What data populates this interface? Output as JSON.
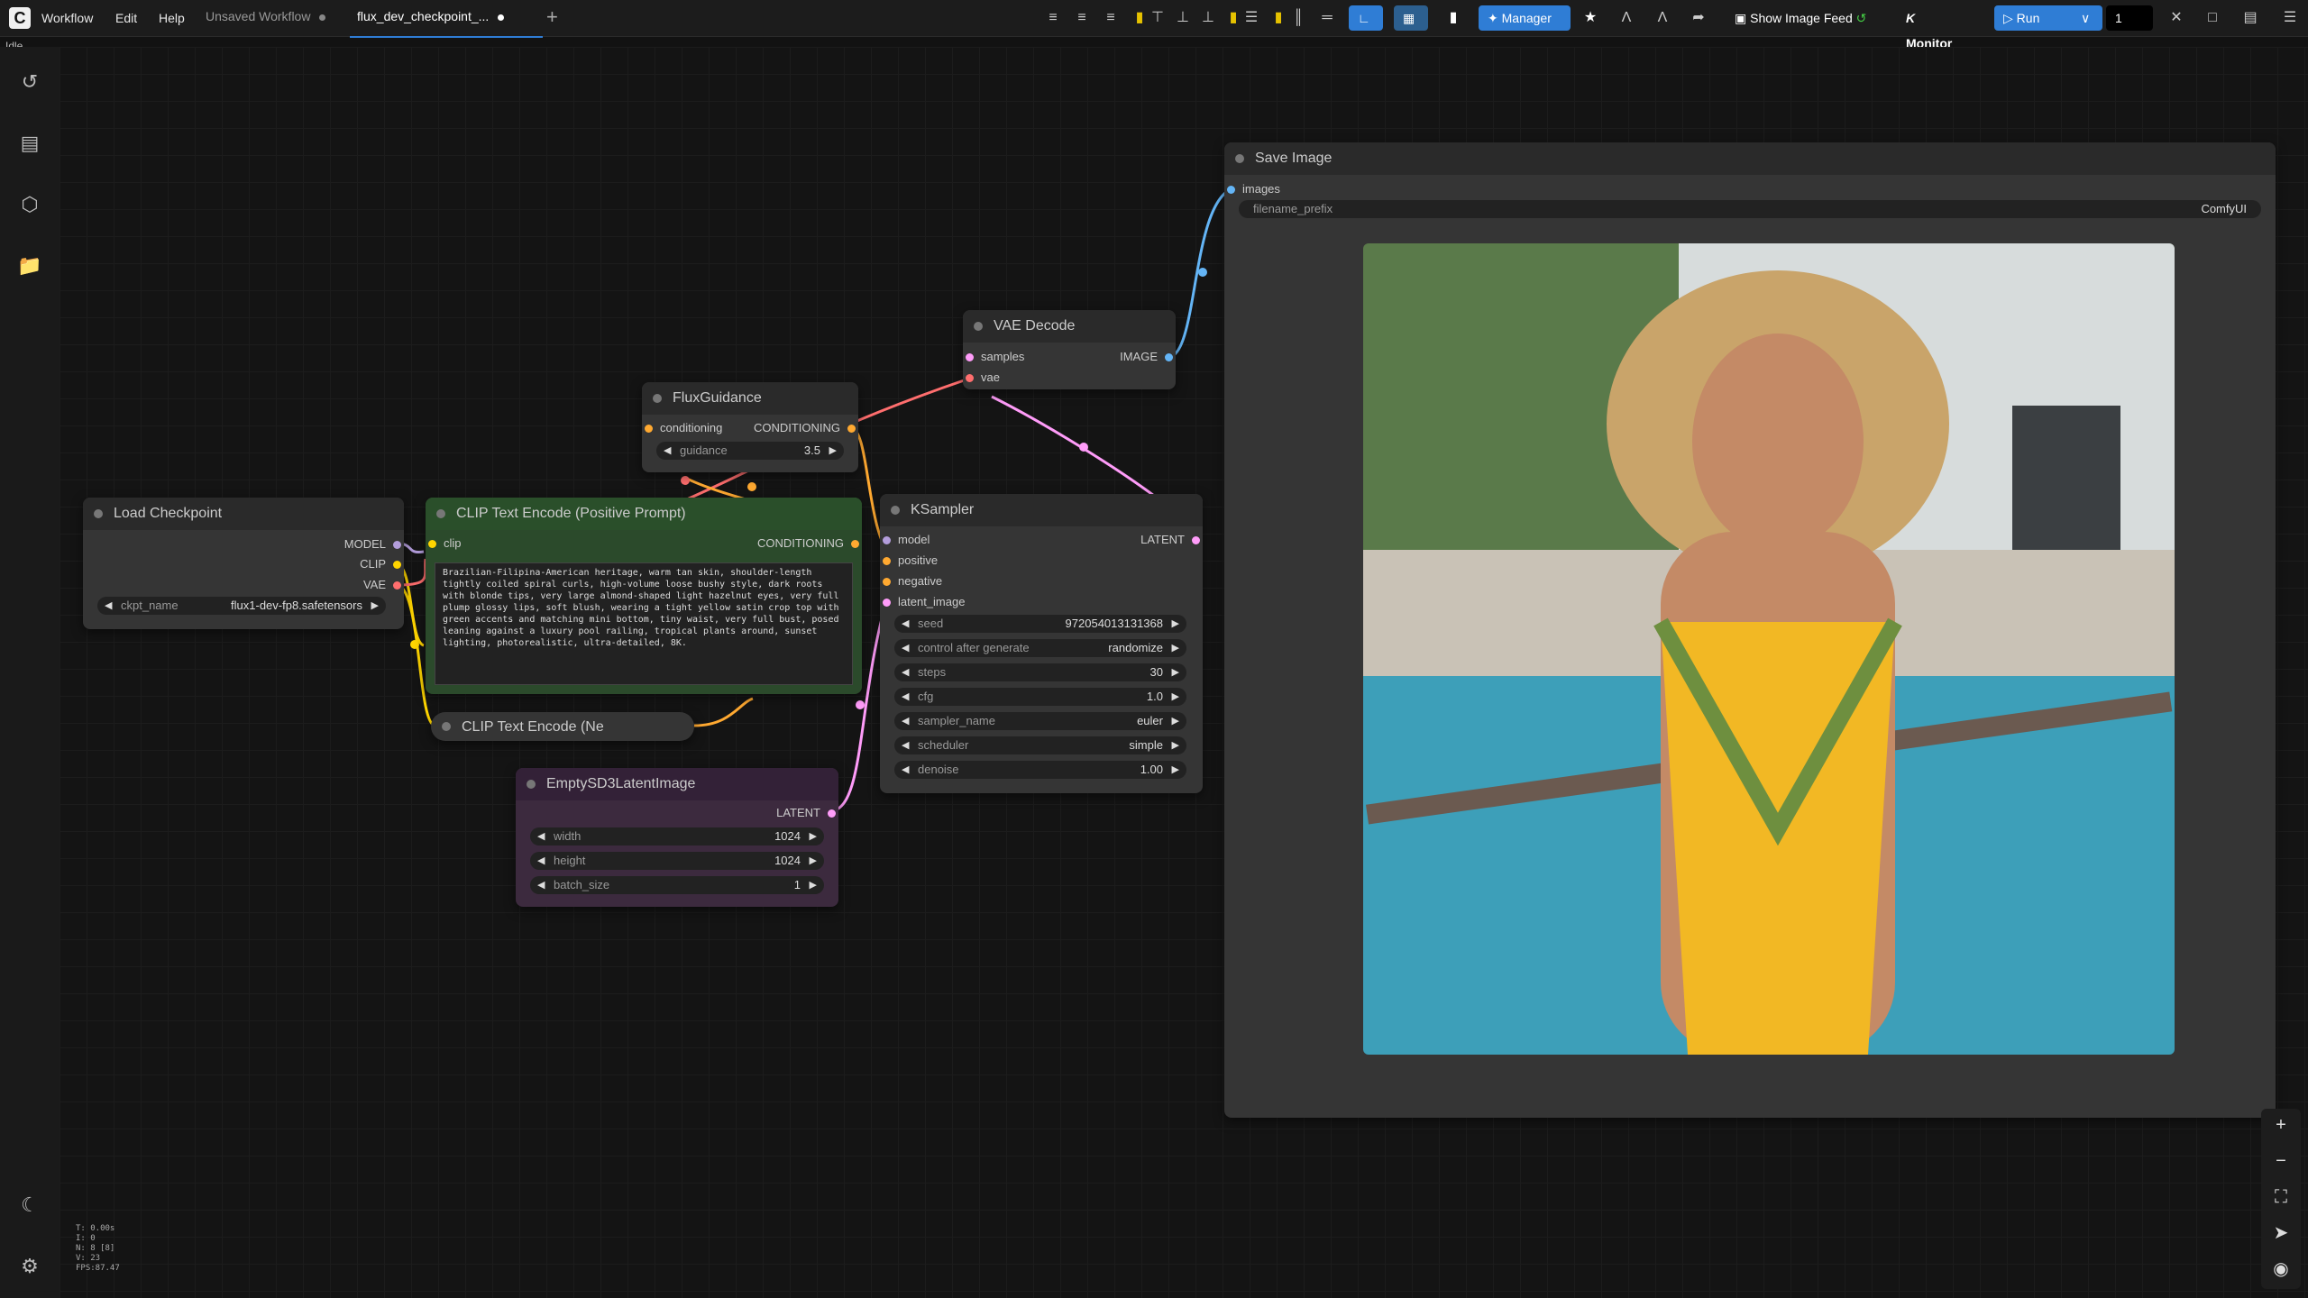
{
  "app": {
    "logo": "C",
    "status": "Idle"
  },
  "menu": {
    "workflow": "Workflow",
    "edit": "Edit",
    "help": "Help"
  },
  "tabs": [
    {
      "label": "Unsaved Workflow"
    },
    {
      "label": "flux_dev_checkpoint_..."
    }
  ],
  "toolbar": {
    "manager_label": "Manager",
    "show_image_feed_label": "Show Image Feed",
    "monitor_label": "Monitor",
    "run_label": "Run",
    "queue_count": "1",
    "colors": {
      "accent": "#2f7dd5",
      "run": "#2f7dd5"
    }
  },
  "nodes": {
    "load_checkpoint": {
      "title": "Load Checkpoint",
      "outputs": [
        "MODEL",
        "CLIP",
        "VAE"
      ],
      "widget": {
        "label": "ckpt_name",
        "value": "flux1-dev-fp8.safetensors"
      }
    },
    "clip_positive": {
      "title": "CLIP Text Encode (Positive Prompt)",
      "input": "clip",
      "output": "CONDITIONING",
      "text": "Brazilian-Filipina-American heritage, warm tan skin, shoulder-length tightly coiled spiral curls, high-volume loose bushy style, dark roots with blonde tips, very large almond-shaped light hazelnut eyes, very full plump glossy lips, soft blush, wearing a tight yellow satin crop top with green accents and matching mini bottom, tiny waist, very full bust, posed leaning against a luxury pool railing, tropical plants around, sunset lighting, photorealistic, ultra-detailed, 8K."
    },
    "clip_negative": {
      "title": "CLIP Text Encode (Ne"
    },
    "flux_guidance": {
      "title": "FluxGuidance",
      "input": "conditioning",
      "output": "CONDITIONING",
      "widget": {
        "label": "guidance",
        "value": "3.5"
      }
    },
    "vae_decode": {
      "title": "VAE Decode",
      "inputs": [
        "samples",
        "vae"
      ],
      "output": "IMAGE"
    },
    "ksampler": {
      "title": "KSampler",
      "inputs": [
        "model",
        "positive",
        "negative",
        "latent_image"
      ],
      "output": "LATENT",
      "widgets": [
        {
          "label": "seed",
          "value": "972054013131368"
        },
        {
          "label": "control after generate",
          "value": "randomize"
        },
        {
          "label": "steps",
          "value": "30"
        },
        {
          "label": "cfg",
          "value": "1.0"
        },
        {
          "label": "sampler_name",
          "value": "euler"
        },
        {
          "label": "scheduler",
          "value": "simple"
        },
        {
          "label": "denoise",
          "value": "1.00"
        }
      ]
    },
    "empty_latent": {
      "title": "EmptySD3LatentImage",
      "output": "LATENT",
      "widgets": [
        {
          "label": "width",
          "value": "1024"
        },
        {
          "label": "height",
          "value": "1024"
        },
        {
          "label": "batch_size",
          "value": "1"
        }
      ]
    },
    "save_image": {
      "title": "Save Image",
      "input": "images",
      "widget": {
        "label": "filename_prefix",
        "value": "ComfyUI"
      }
    }
  },
  "stats": [
    "T: 0.00s",
    "I: 0",
    "N: 8 [8]",
    "V: 23",
    "FPS:87.47"
  ],
  "icons": {
    "history": "history-icon",
    "queue": "queue-icon",
    "model_library": "cube-icon",
    "workflows": "folder-icon",
    "theme": "moon-icon",
    "settings": "gear-icon"
  }
}
